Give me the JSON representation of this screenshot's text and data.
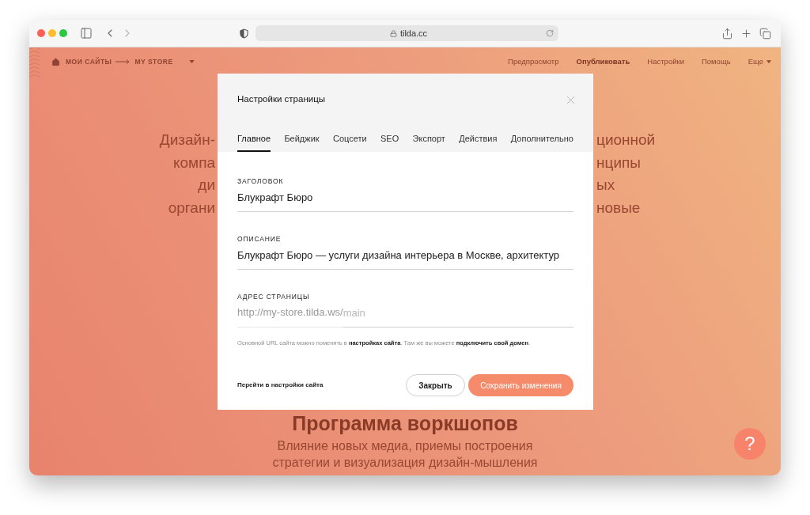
{
  "browser": {
    "url": "tilda.cc"
  },
  "header": {
    "breadcrumbs": [
      "МОИ САЙТЫ",
      "MY STORE"
    ],
    "nav": [
      {
        "label": "Предпросмотр",
        "kind": "link"
      },
      {
        "label": "Опубликовать",
        "kind": "primary"
      },
      {
        "label": "Настройки",
        "kind": "link"
      },
      {
        "label": "Помощь",
        "kind": "link"
      },
      {
        "label": "Еще",
        "kind": "dropdown"
      }
    ]
  },
  "background": {
    "intro_fragments": [
      {
        "left": "Дизайн-",
        "right": "ционной"
      },
      {
        "left": "компа",
        "right": "нципы"
      },
      {
        "left": "ди",
        "right": "ых"
      },
      {
        "left": "органи",
        "right": "новые"
      }
    ],
    "heading": "Программа воркшопов",
    "subtitle_lines": [
      "Влияние новых медиа, приемы построения",
      "стратегии и визуализация дизайн-мышления"
    ]
  },
  "modal": {
    "title": "Настройки страницы",
    "tabs": [
      {
        "label": "Главное",
        "selected": true
      },
      {
        "label": "Бейджик",
        "selected": false
      },
      {
        "label": "Соцсети",
        "selected": false
      },
      {
        "label": "SEO",
        "selected": false
      },
      {
        "label": "Экспорт",
        "selected": false
      },
      {
        "label": "Действия",
        "selected": false
      },
      {
        "label": "Дополнительно",
        "selected": false
      }
    ],
    "fields": [
      {
        "kind": "text",
        "label": "ЗАГОЛОВОК",
        "value": "Блукрафт Бюро"
      },
      {
        "kind": "text",
        "label": "ОПИСАНИЕ",
        "value": "Блукрафт Бюро — услуги дизайна интерьера в Москве, архитектур"
      },
      {
        "kind": "url",
        "label": "АДРЕС СТРАНИЦЫ",
        "prefix": "http://my-store.tilda.ws/",
        "placeholder": "main"
      }
    ],
    "hint": [
      {
        "kind": "text",
        "text": "Основной URL сайта можно поменять в "
      },
      {
        "kind": "link",
        "text": "настройках сайта"
      },
      {
        "kind": "text",
        "text": ". Там же вы можете "
      },
      {
        "kind": "link",
        "text": "подключить свой домен"
      },
      {
        "kind": "text",
        "text": "."
      }
    ],
    "footer_link": "Перейти в настройки сайта",
    "buttons": [
      {
        "label": "Закрыть",
        "kind": "secondary"
      },
      {
        "label": "Сохранить изменения",
        "kind": "primary"
      }
    ]
  },
  "help_button": {
    "label": "?"
  }
}
